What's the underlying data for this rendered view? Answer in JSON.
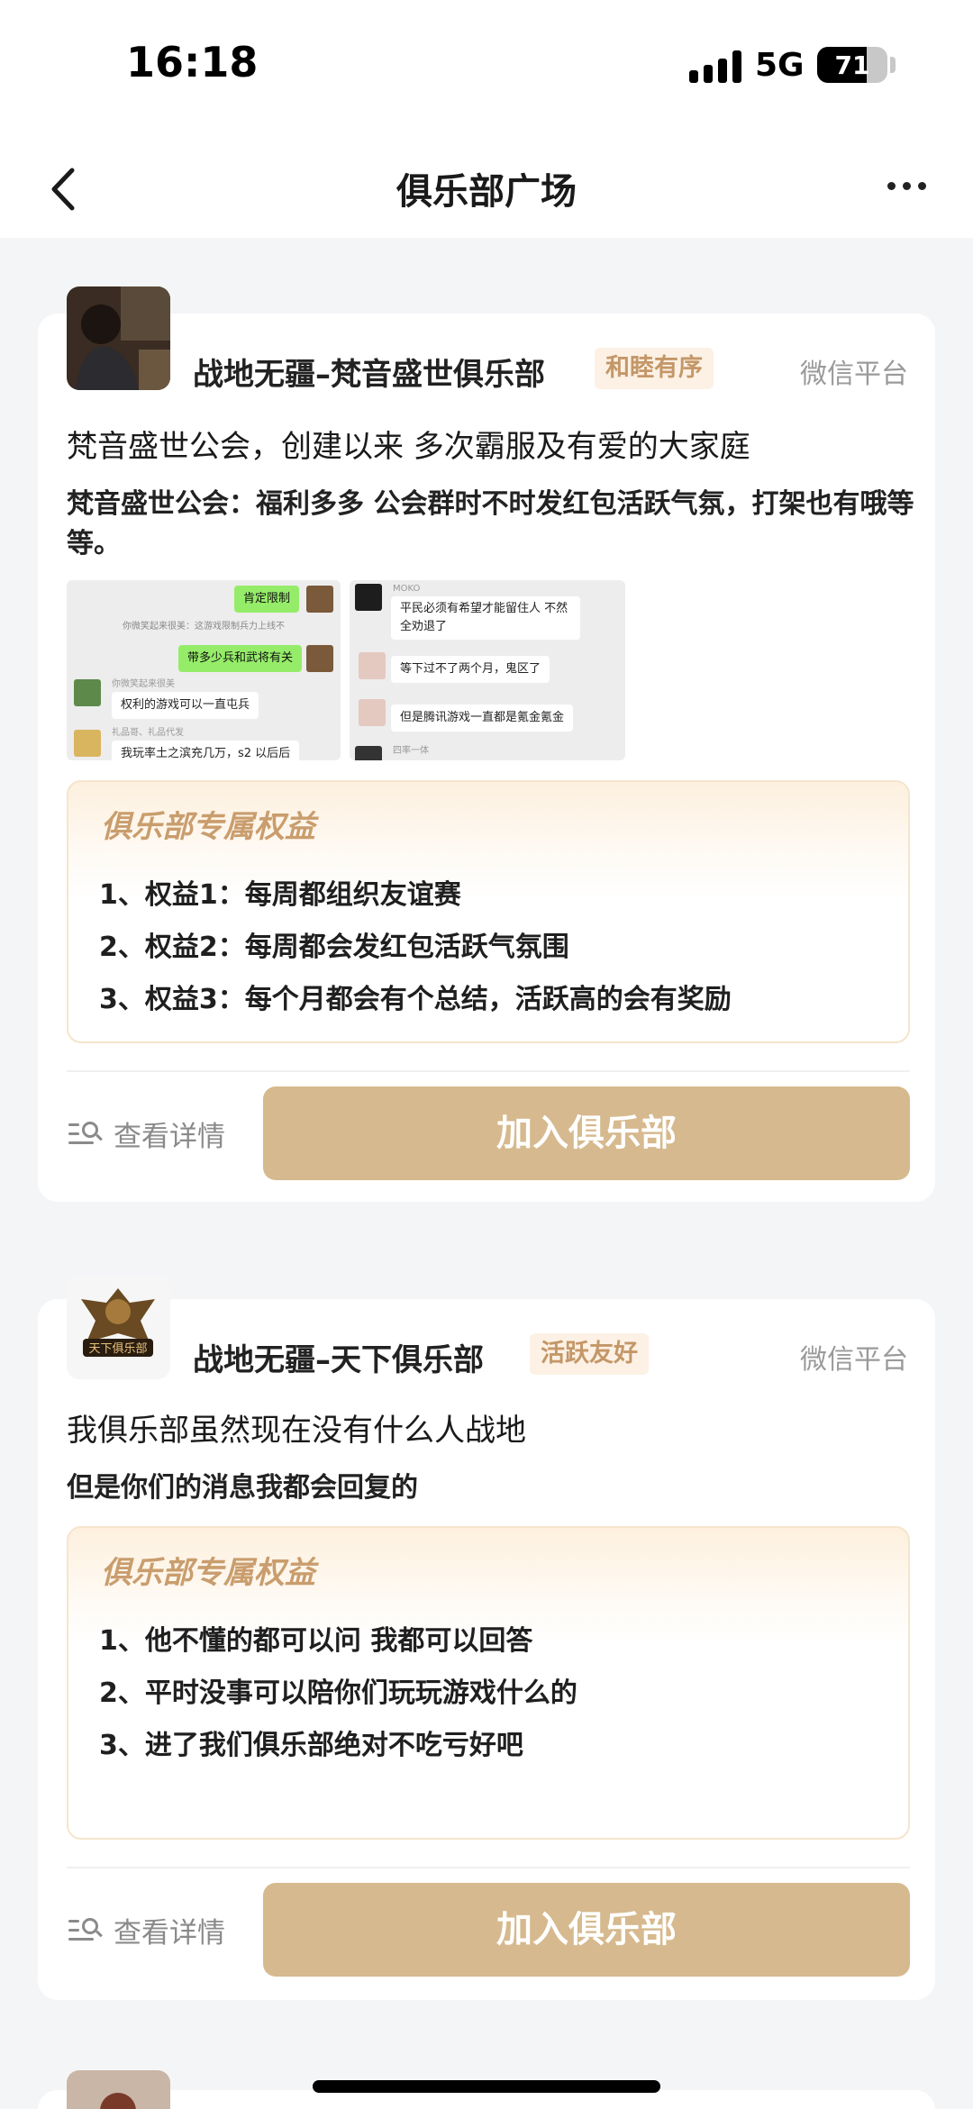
{
  "status_bar": {
    "time": "16:18",
    "network": "5G",
    "battery": "71"
  },
  "nav": {
    "title": "俱乐部广场"
  },
  "clubs": [
    {
      "name": "战地无疆–梵音盛世俱乐部",
      "tag": "和睦有序",
      "platform": "微信平台",
      "headline": "梵音盛世公会，创建以来 多次霸服及有爱的大家庭",
      "description": "梵音盛世公会：福利多多 公会群时不时发红包活跃气氛，打架也有哦等等。",
      "screenshots": [
        {
          "messages": [
            "肯定限制",
            "你微笑起来很美：这游戏限制兵力上线不",
            "带多少兵和武将有关",
            "你微笑起来很美",
            "权利的游戏可以一直屯兵",
            "礼品哥、礼品代发",
            "我玩率土之滨充几万，s2 以后后"
          ]
        },
        {
          "messages": [
            "MOKO",
            "平民必须有希望才能留住人 不然全劝退了",
            "等下过不了两个月，鬼区了",
            "但是腾讯游戏一直都是氪金氪金",
            "四率一体"
          ]
        }
      ],
      "benefits_title": "俱乐部专属权益",
      "benefits": [
        "1、权益1：每周都组织友谊赛",
        "2、权益2：每周都会发红包活跃气氛围",
        "3、权益3：每个月都会有个总结，活跃高的会有奖励"
      ],
      "detail_label": "查看详情",
      "join_label": "加入俱乐部"
    },
    {
      "name": "战地无疆–天下俱乐部",
      "tag": "活跃友好",
      "platform": "微信平台",
      "avatar_text": "天下俱乐部",
      "headline": "我俱乐部虽然现在没有什么人战地",
      "description": "但是你们的消息我都会回复的",
      "benefits_title": "俱乐部专属权益",
      "benefits": [
        "1、他不懂的都可以问 我都可以回答",
        "2、平时没事可以陪你们玩玩游戏什么的",
        "3、进了我们俱乐部绝对不吃亏好吧"
      ],
      "detail_label": "查看详情",
      "join_label": "加入俱乐部"
    }
  ],
  "colors": {
    "accent": "#d6b98e",
    "tag_bg": "#fcf1e4",
    "tag_text": "#c49768",
    "benefit_title": "#c99d6d",
    "page_bg": "#f4f5f7"
  },
  "icons": [
    "back-arrow-icon",
    "more-icon",
    "detail-list-search-icon",
    "signal-icon",
    "battery-icon"
  ]
}
